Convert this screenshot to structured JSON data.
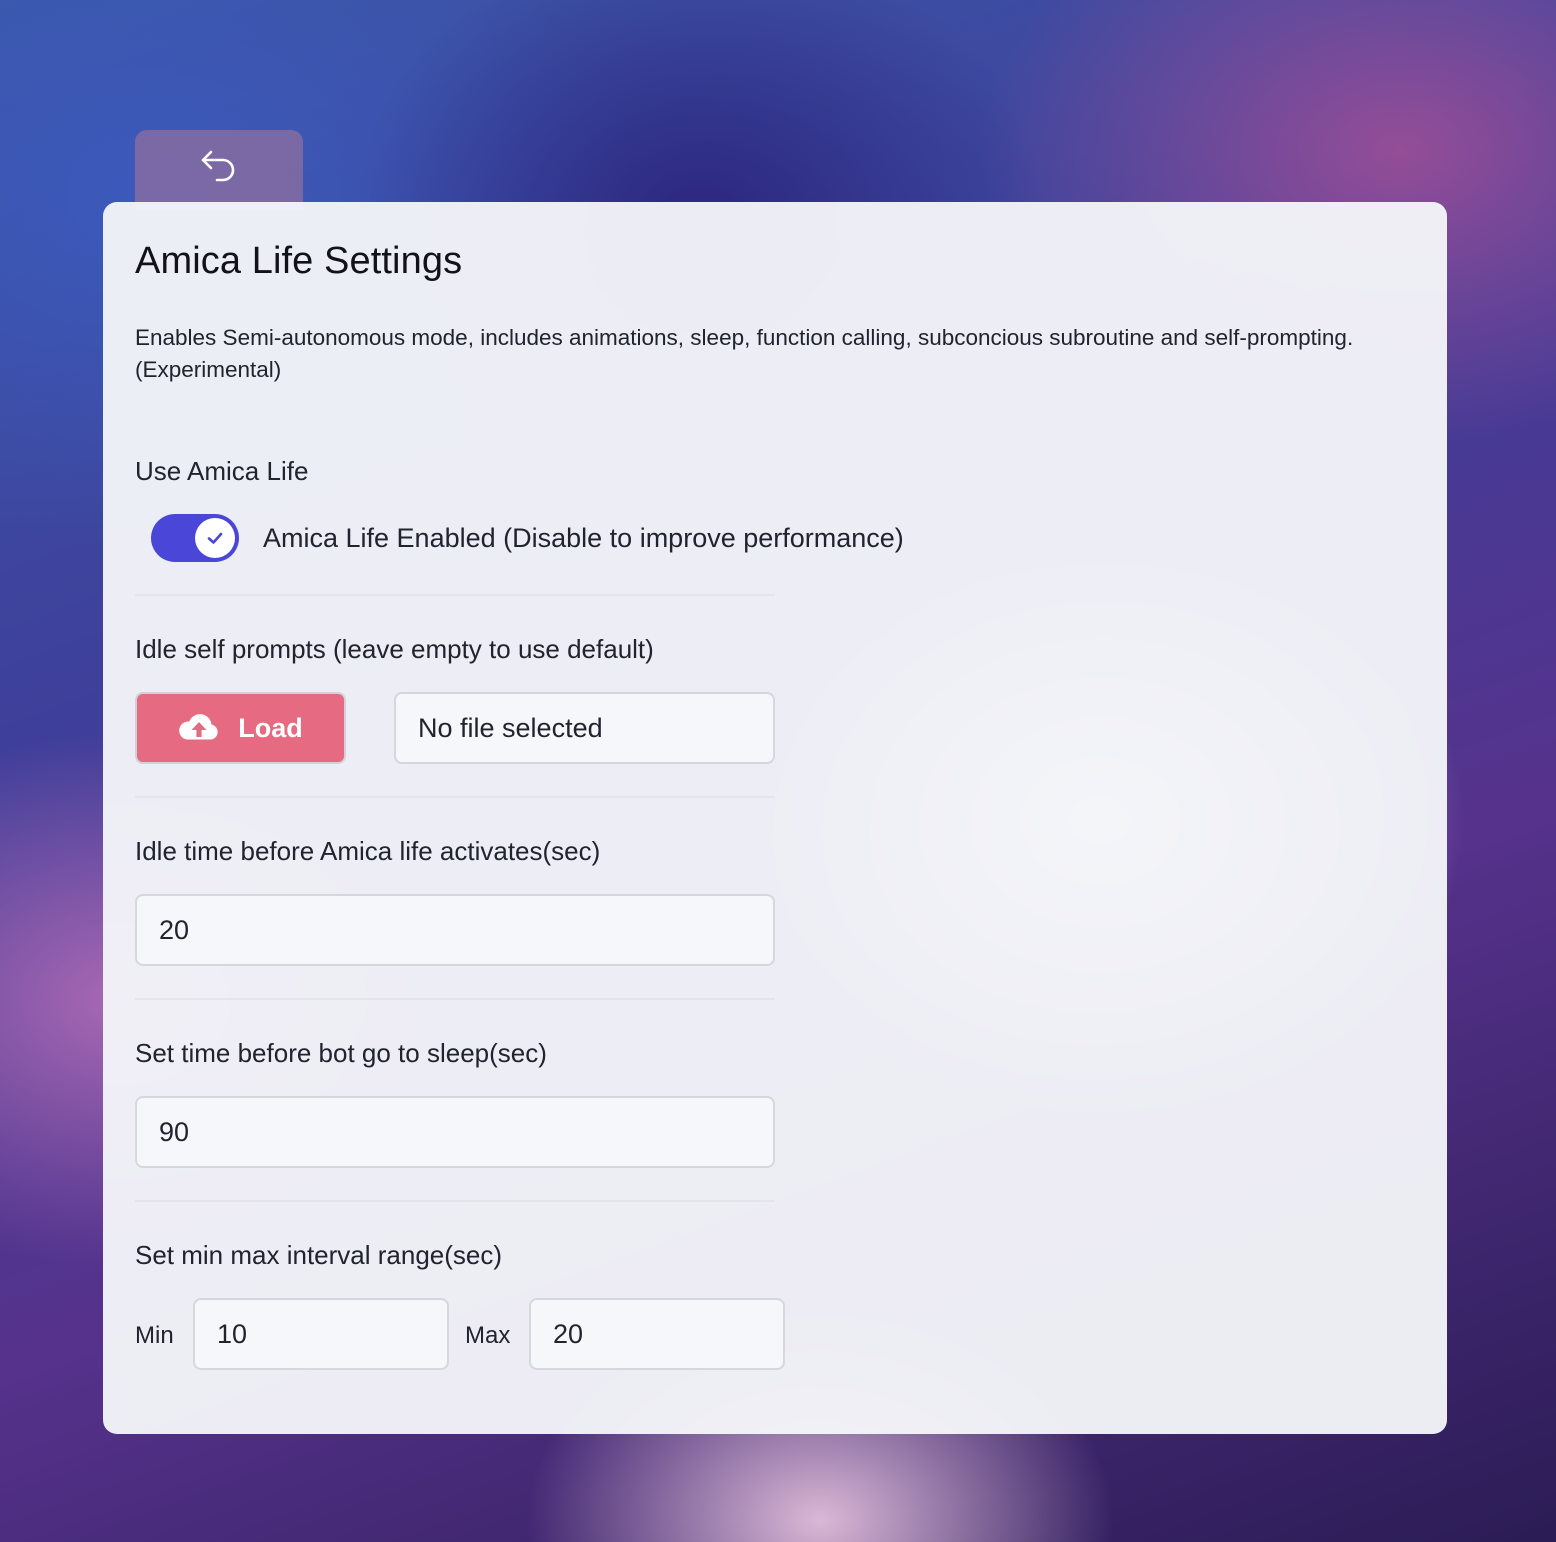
{
  "background": {
    "accent": "#4a47d8",
    "load_button_color": "#e66a81"
  },
  "back_button": {
    "icon": "undo-arrow-icon"
  },
  "settings": {
    "title": "Amica Life Settings",
    "description": "Enables Semi-autonomous mode, includes animations, sleep, function calling, subconcious subroutine and self-prompting. (Experimental)",
    "use_amica_life": {
      "label": "Use Amica Life",
      "toggle_enabled": true,
      "toggle_text": "Amica Life Enabled (Disable to improve performance)"
    },
    "idle_self_prompts": {
      "label": "Idle self prompts (leave empty to use default)",
      "load_button_label": "Load",
      "load_icon": "cloud-upload-icon",
      "file_status": "No file selected"
    },
    "idle_time": {
      "label": "Idle time before Amica life activates(sec)",
      "value": "20"
    },
    "sleep_time": {
      "label": "Set time before bot go to sleep(sec)",
      "value": "90"
    },
    "interval_range": {
      "label": "Set min max interval range(sec)",
      "min_label": "Min",
      "min_value": "10",
      "max_label": "Max",
      "max_value": "20"
    }
  }
}
